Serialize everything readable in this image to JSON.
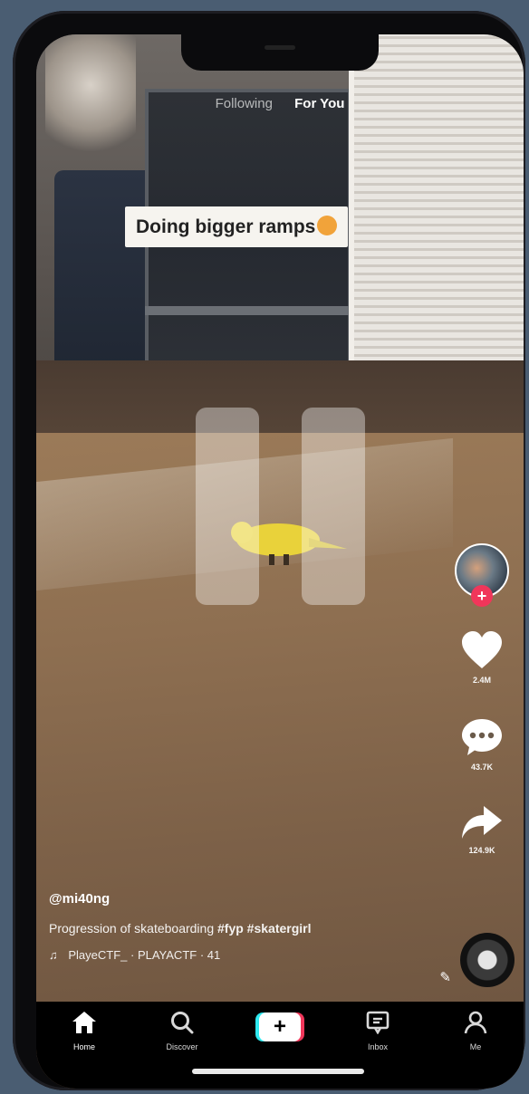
{
  "top_tabs": {
    "following": "Following",
    "for_you": "For You"
  },
  "caption_sticker": "Doing bigger ramps",
  "side_actions": {
    "likes": "2.4M",
    "comments": "43.7K",
    "shares": "124.9K"
  },
  "post": {
    "username": "@mi40ng",
    "description": "Progression of skateboarding",
    "hashtags": "#fyp #skatergirl",
    "music": "PlayeCTF_ · PLAYACTF · 41"
  },
  "tabbar": {
    "home": "Home",
    "discover": "Discover",
    "inbox": "Inbox",
    "me": "Me"
  },
  "icons": {
    "heart": "heart-icon",
    "comment": "comment-icon",
    "share": "share-icon",
    "home": "home-icon",
    "discover": "search-icon",
    "create": "plus-icon",
    "inbox": "inbox-icon",
    "me": "person-icon"
  },
  "colors": {
    "follow_accent": "#f0365a",
    "create_cyan": "#2ee9f0",
    "create_red": "#f0365a"
  }
}
